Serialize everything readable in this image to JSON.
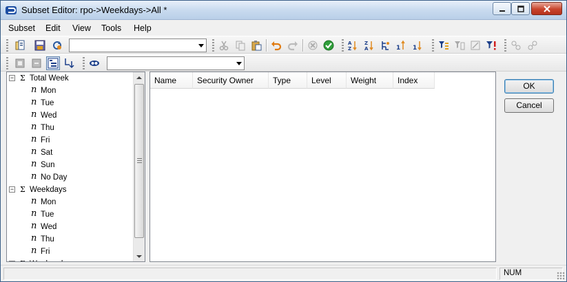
{
  "window": {
    "title": "Subset Editor:  rpo->Weekdays->All  *"
  },
  "menubar": {
    "items": [
      "Subset",
      "Edit",
      "View",
      "Tools",
      "Help"
    ]
  },
  "toolbar": {
    "subset_combo_value": "",
    "filter_combo_value": "",
    "icons": {
      "row1": [
        "open-subset-icon",
        "save-subset-icon",
        "refresh-icon",
        "cut-icon",
        "copy-icon",
        "paste-icon",
        "undo-icon",
        "redo-icon",
        "cancel-icon",
        "ok-check-icon",
        "sort-asc-icon",
        "sort-desc-icon",
        "sort-hierarchy-icon",
        "sort-index-asc-icon",
        "sort-index-desc-icon",
        "filter-level-icon",
        "filter-attribute-icon",
        "filter-expression-icon",
        "filter-by-icon",
        "expand-icon",
        "collapse-icon"
      ],
      "row2": [
        "keep-icon",
        "delete-icon",
        "tree-view-icon",
        "drill-down-icon",
        "alias-icon"
      ]
    }
  },
  "tree": {
    "groups": [
      {
        "label": "Total Week",
        "children": [
          "Mon",
          "Tue",
          "Wed",
          "Thu",
          "Fri",
          "Sat",
          "Sun",
          "No Day"
        ]
      },
      {
        "label": "Weekdays",
        "children": [
          "Mon",
          "Tue",
          "Wed",
          "Thu",
          "Fri"
        ]
      },
      {
        "label": "Weekends",
        "children": []
      }
    ]
  },
  "grid": {
    "columns": [
      "Name",
      "Security Owner",
      "Type",
      "Level",
      "Weight",
      "Index"
    ]
  },
  "buttons": {
    "ok": "OK",
    "cancel": "Cancel"
  },
  "status": {
    "num": "NUM"
  },
  "colors": {
    "accent": "#3c7fb1",
    "ok_check": "#2f9e3a"
  }
}
